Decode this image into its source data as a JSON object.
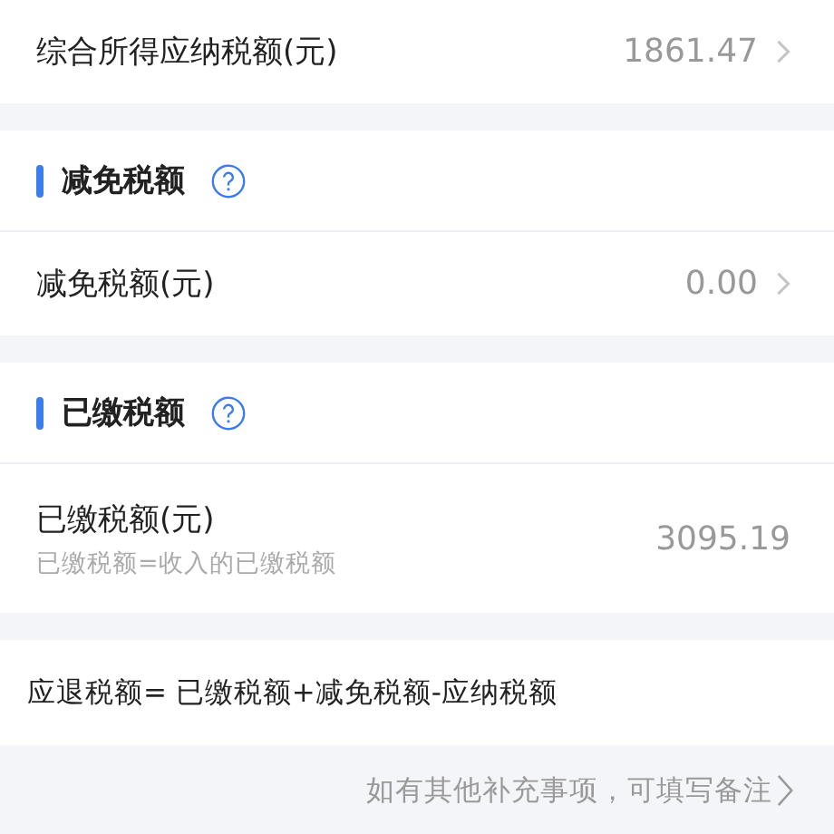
{
  "summary_row": {
    "label": "综合所得应纳税额(元)",
    "value": "1861.47",
    "chevron": true
  },
  "sections": [
    {
      "title": "减免税额",
      "rows": [
        {
          "label": "减免税额(元)",
          "value": "0.00",
          "chevron": true
        }
      ]
    },
    {
      "title": "已缴税额",
      "rows": [
        {
          "label": "已缴税额(元)",
          "hint": "已缴税额=收入的已缴税额",
          "value": "3095.19",
          "chevron": false
        }
      ]
    }
  ],
  "formula": "应退税额= 已缴税额+减免税额-应纳税额",
  "note": "如有其他补充事项，可填写备注"
}
